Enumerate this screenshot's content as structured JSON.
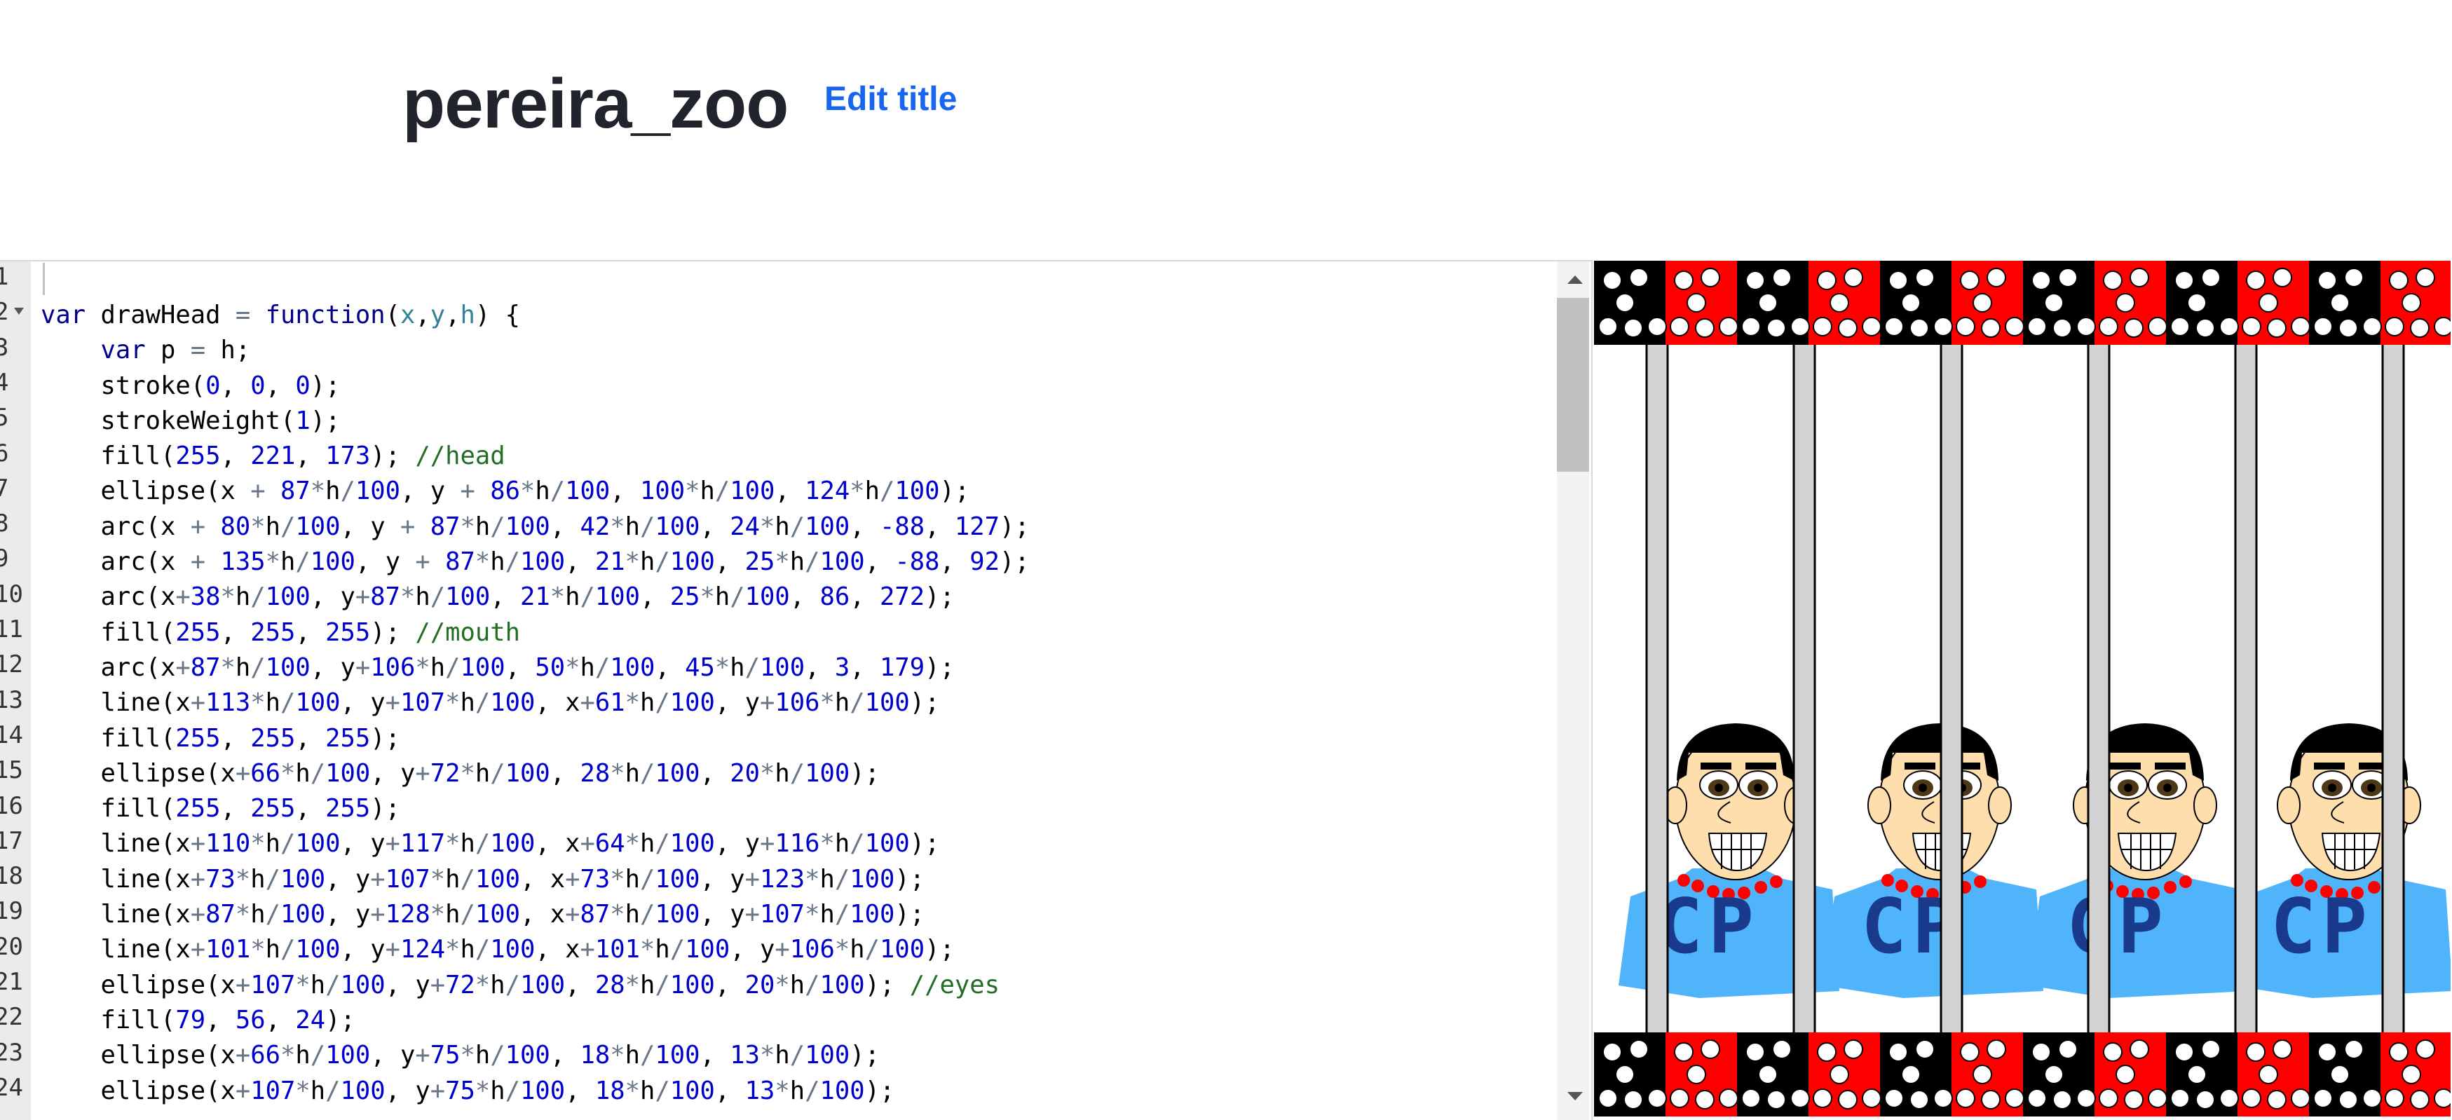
{
  "header": {
    "title": "pereira_zoo",
    "edit_label": "Edit title"
  },
  "editor": {
    "line_numbers": [
      "1",
      "2",
      "3",
      "4",
      "5",
      "6",
      "7",
      "8",
      "9",
      "10",
      "11",
      "12",
      "13",
      "14",
      "15",
      "16",
      "17",
      "18",
      "19",
      "20",
      "21",
      "22",
      "23",
      "24"
    ],
    "code_lines": [
      "var drawHead = function(x,y,h) {",
      "    var p = h;",
      "    stroke(0, 0, 0);",
      "    strokeWeight(1);",
      "    fill(255, 221, 173); //head",
      "    ellipse(x + 87*h/100, y + 86*h/100, 100*h/100, 124*h/100);",
      "    arc(x + 80*h/100, y + 87*h/100, 42*h/100, 24*h/100, -88, 127);",
      "    arc(x + 135*h/100, y + 87*h/100, 21*h/100, 25*h/100, -88, 92);",
      "    arc(x+38*h/100, y+87*h/100, 21*h/100, 25*h/100, 86, 272);",
      "    fill(255, 255, 255); //mouth",
      "    arc(x+87*h/100, y+106*h/100, 50*h/100, 45*h/100, 3, 179);",
      "    line(x+113*h/100, y+107*h/100, x+61*h/100, y+106*h/100);",
      "    fill(255, 255, 255);",
      "    ellipse(x+66*h/100, y+72*h/100, 28*h/100, 20*h/100);",
      "    fill(255, 255, 255);",
      "    line(x+110*h/100, y+117*h/100, x+64*h/100, y+116*h/100);",
      "    line(x+73*h/100, y+107*h/100, x+73*h/100, y+123*h/100);",
      "    line(x+87*h/100, y+128*h/100, x+87*h/100, y+107*h/100);",
      "    line(x+101*h/100, y+124*h/100, x+101*h/100, y+106*h/100);",
      "    ellipse(x+107*h/100, y+72*h/100, 28*h/100, 20*h/100); //eyes",
      "    fill(79, 56, 24);",
      "    ellipse(x+66*h/100, y+75*h/100, 18*h/100, 13*h/100);",
      "    ellipse(x+107*h/100, y+75*h/100, 18*h/100, 13*h/100);"
    ]
  },
  "canvas": {
    "shirt_text": "CP",
    "colors": {
      "border_red": "#ff0000",
      "border_black": "#000000",
      "bars": "#d3d3d3",
      "skin": "#ffdead",
      "shirt": "#4fb4fa",
      "shirt_text": "#1a3a8c",
      "necklace": "#ff0000"
    }
  }
}
